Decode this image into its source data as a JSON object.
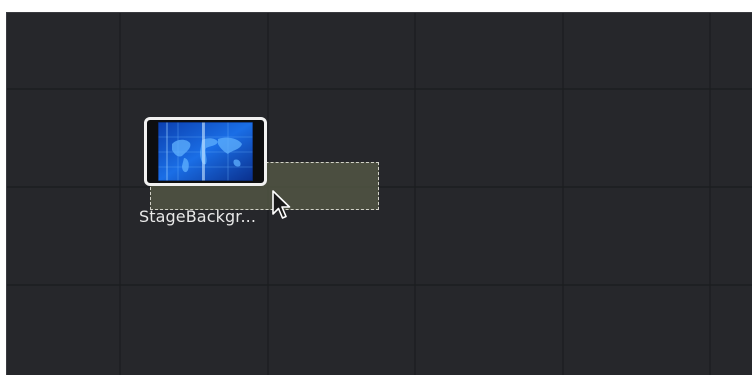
{
  "node_editor": {
    "background_color": "#26272b",
    "grid_color": "#1b1c1f",
    "selection_color": "#585c48",
    "nodes": [
      {
        "label": "StageBackgr...",
        "thumbnail": "world-map-blue-thumbnail",
        "selected": true
      }
    ],
    "cursor": "arrow-pointer-icon"
  }
}
